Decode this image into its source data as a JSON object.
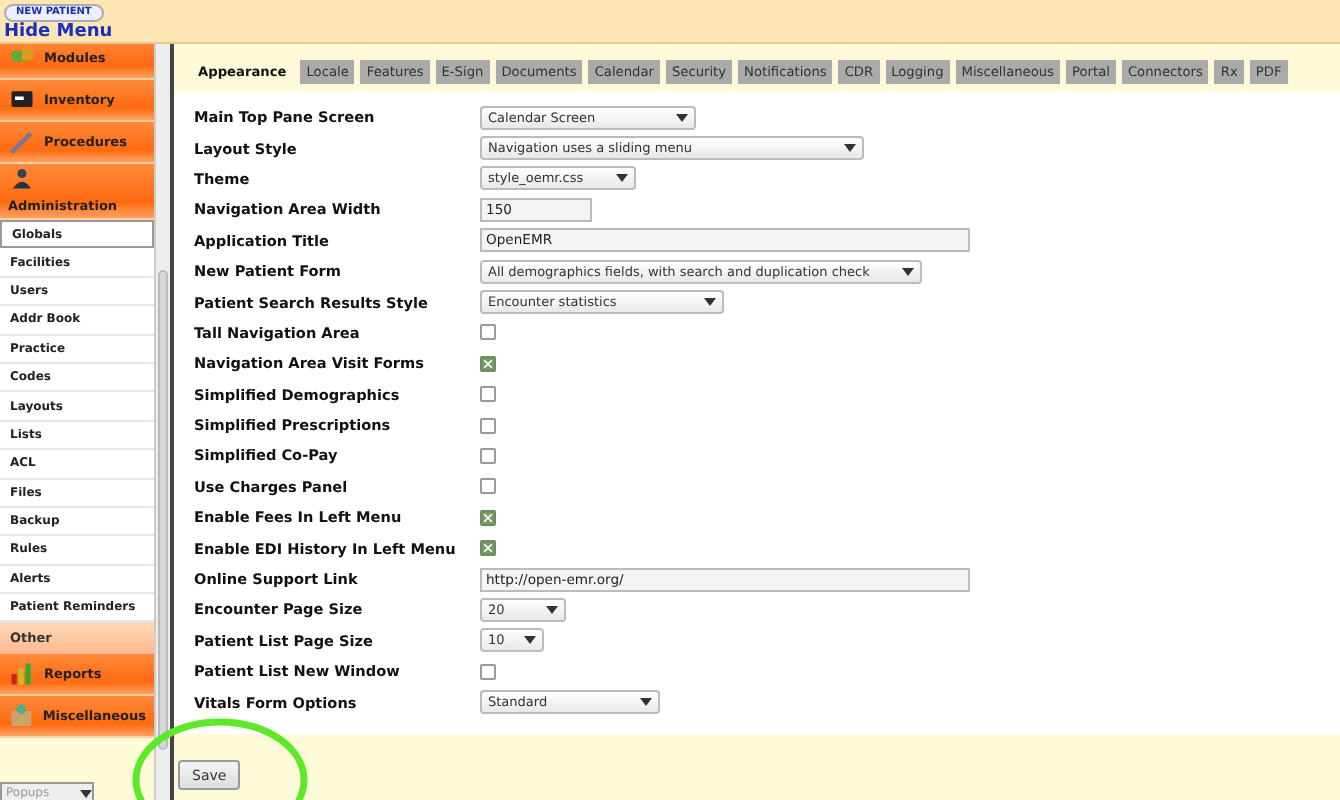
{
  "top_bar": {
    "new_patient_button": "NEW PATIENT",
    "hide_menu_link": "Hide Menu"
  },
  "sidebar": {
    "items": [
      {
        "label": "Modules",
        "kind": "section",
        "expanded": false
      },
      {
        "label": "Inventory",
        "kind": "section",
        "expanded": false
      },
      {
        "label": "Procedures",
        "kind": "section",
        "expanded": false
      },
      {
        "label": "Administration",
        "kind": "section",
        "expanded": true
      },
      {
        "label": "Globals",
        "kind": "link",
        "selected": true
      },
      {
        "label": "Facilities",
        "kind": "link",
        "selected": false
      },
      {
        "label": "Users",
        "kind": "link",
        "selected": false
      },
      {
        "label": "Addr Book",
        "kind": "link",
        "selected": false
      },
      {
        "label": "Practice",
        "kind": "link",
        "selected": false
      },
      {
        "label": "Codes",
        "kind": "link",
        "selected": false
      },
      {
        "label": "Layouts",
        "kind": "link",
        "selected": false
      },
      {
        "label": "Lists",
        "kind": "link",
        "selected": false
      },
      {
        "label": "ACL",
        "kind": "link",
        "selected": false
      },
      {
        "label": "Files",
        "kind": "link",
        "selected": false
      },
      {
        "label": "Backup",
        "kind": "link",
        "selected": false
      },
      {
        "label": "Rules",
        "kind": "link",
        "selected": false
      },
      {
        "label": "Alerts",
        "kind": "link",
        "selected": false
      },
      {
        "label": "Patient Reminders",
        "kind": "link",
        "selected": false
      },
      {
        "label": "Other",
        "kind": "group"
      },
      {
        "label": "Reports",
        "kind": "section",
        "expanded": false
      },
      {
        "label": "Miscellaneous",
        "kind": "section",
        "expanded": false
      }
    ],
    "popups_select": "Popups"
  },
  "tabs": [
    {
      "label": "Appearance",
      "selected": true
    },
    {
      "label": "Locale",
      "selected": false
    },
    {
      "label": "Features",
      "selected": false
    },
    {
      "label": "E-Sign",
      "selected": false
    },
    {
      "label": "Documents",
      "selected": false
    },
    {
      "label": "Calendar",
      "selected": false
    },
    {
      "label": "Security",
      "selected": false
    },
    {
      "label": "Notifications",
      "selected": false
    },
    {
      "label": "CDR",
      "selected": false
    },
    {
      "label": "Logging",
      "selected": false
    },
    {
      "label": "Miscellaneous",
      "selected": false
    },
    {
      "label": "Portal",
      "selected": false
    },
    {
      "label": "Connectors",
      "selected": false
    },
    {
      "label": "Rx",
      "selected": false
    },
    {
      "label": "PDF",
      "selected": false
    }
  ],
  "settings": [
    {
      "label": "Main Top Pane Screen",
      "kind": "select",
      "value": "Calendar Screen"
    },
    {
      "label": "Layout Style",
      "kind": "select",
      "value": "Navigation uses a sliding menu"
    },
    {
      "label": "Theme",
      "kind": "select",
      "value": "style_oemr.css"
    },
    {
      "label": "Navigation Area Width",
      "kind": "text",
      "value": "150"
    },
    {
      "label": "Application Title",
      "kind": "text",
      "value": "OpenEMR"
    },
    {
      "label": "New Patient Form",
      "kind": "select",
      "value": "All demographics fields, with search and duplication check"
    },
    {
      "label": "Patient Search Results Style",
      "kind": "select",
      "value": "Encounter statistics"
    },
    {
      "label": "Tall Navigation Area",
      "kind": "checkbox",
      "checked": false
    },
    {
      "label": "Navigation Area Visit Forms",
      "kind": "checkbox",
      "checked": true
    },
    {
      "label": "Simplified Demographics",
      "kind": "checkbox",
      "checked": false
    },
    {
      "label": "Simplified Prescriptions",
      "kind": "checkbox",
      "checked": false
    },
    {
      "label": "Simplified Co-Pay",
      "kind": "checkbox",
      "checked": false
    },
    {
      "label": "Use Charges Panel",
      "kind": "checkbox",
      "checked": false
    },
    {
      "label": "Enable Fees In Left Menu",
      "kind": "checkbox",
      "checked": true
    },
    {
      "label": "Enable EDI History In Left Menu",
      "kind": "checkbox",
      "checked": true
    },
    {
      "label": "Online Support Link",
      "kind": "text",
      "value": "http://open-emr.org/"
    },
    {
      "label": "Encounter Page Size",
      "kind": "select",
      "value": "20"
    },
    {
      "label": "Patient List Page Size",
      "kind": "select",
      "value": "10"
    },
    {
      "label": "Patient List New Window",
      "kind": "checkbox",
      "checked": false
    },
    {
      "label": "Vitals Form Options",
      "kind": "select",
      "value": "Standard"
    }
  ],
  "save_button": "Save"
}
